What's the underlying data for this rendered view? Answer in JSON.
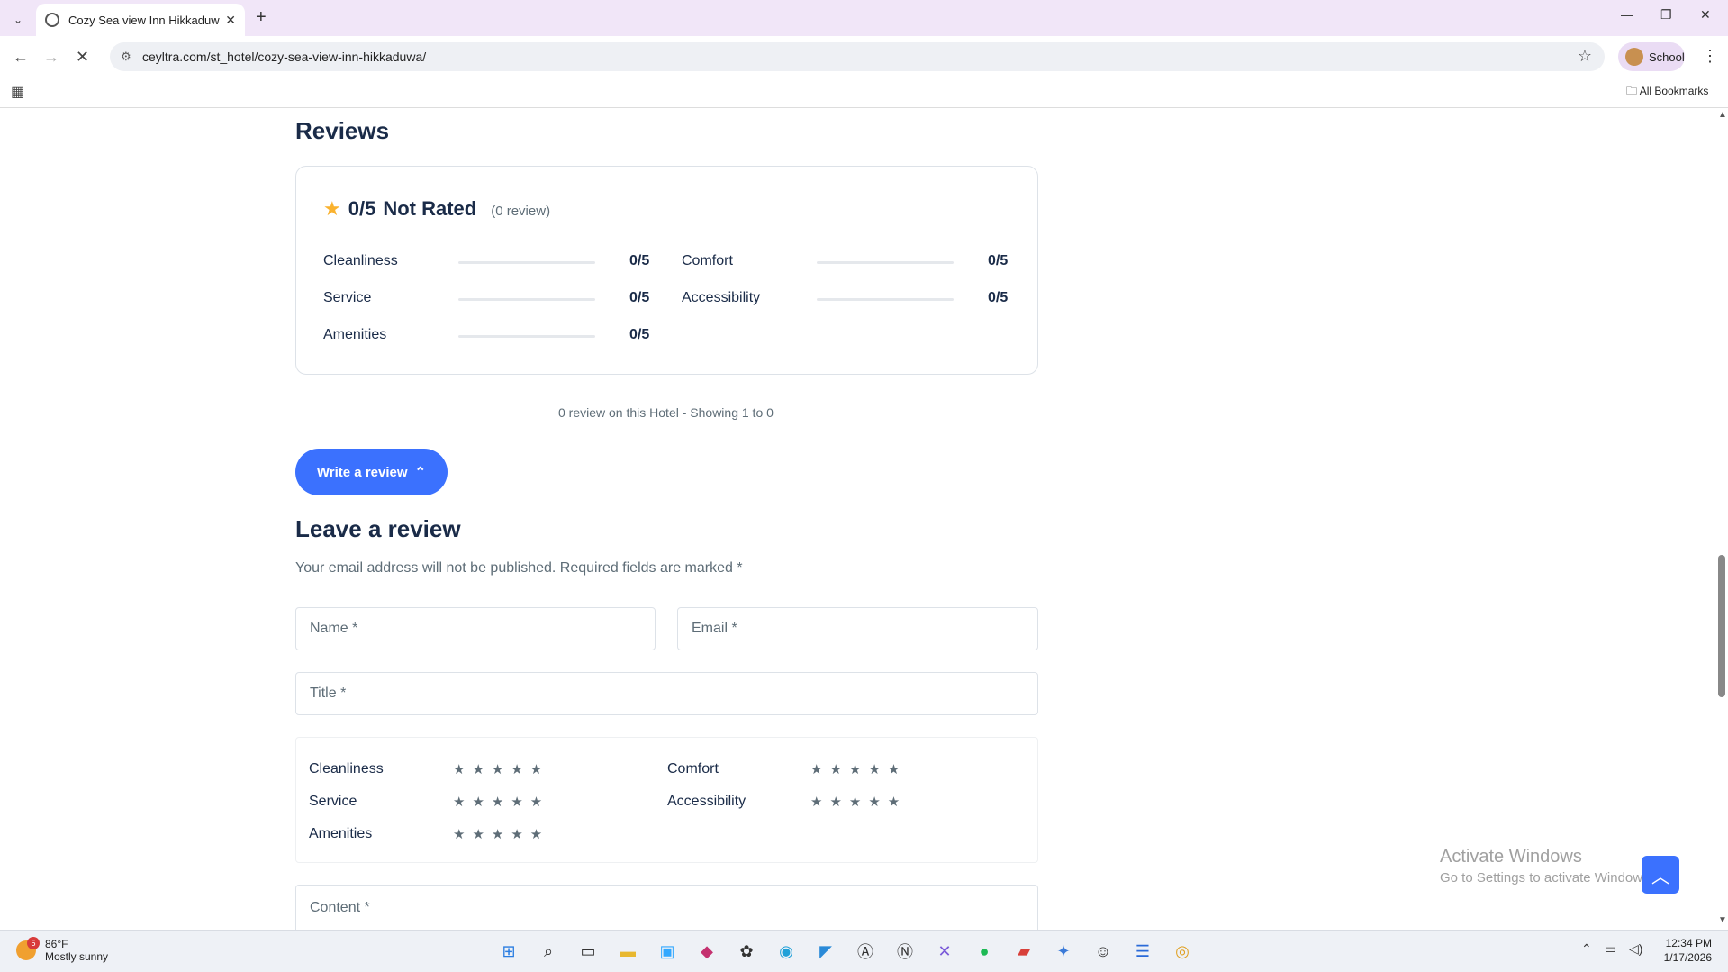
{
  "browser": {
    "tab_title": "Cozy Sea view Inn Hikkaduwa -",
    "url": "ceyltra.com/st_hotel/cozy-sea-view-inn-hikkaduwa/",
    "profile_label": "School",
    "bookmarks_label": "All Bookmarks"
  },
  "reviews": {
    "heading": "Reviews",
    "score": "0/5",
    "status": "Not Rated",
    "count": "(0 review)",
    "criteria": [
      {
        "label": "Cleanliness",
        "value": "0/5"
      },
      {
        "label": "Comfort",
        "value": "0/5"
      },
      {
        "label": "Service",
        "value": "0/5"
      },
      {
        "label": "Accessibility",
        "value": "0/5"
      },
      {
        "label": "Amenities",
        "value": "0/5"
      }
    ],
    "showing": "0 review on this Hotel - Showing 1 to 0",
    "write_button": "Write a review"
  },
  "form": {
    "heading": "Leave a review",
    "note": "Your email address will not be published. Required fields are marked *",
    "name_placeholder": "Name *",
    "email_placeholder": "Email *",
    "title_placeholder": "Title *",
    "content_placeholder": "Content *",
    "ratings": [
      {
        "label": "Cleanliness",
        "stars": "★★★★★"
      },
      {
        "label": "Comfort",
        "stars": "★★★★★"
      },
      {
        "label": "Service",
        "stars": "★★★★★"
      },
      {
        "label": "Accessibility",
        "stars": "★★★★★"
      },
      {
        "label": "Amenities",
        "stars": "★★★★★"
      }
    ]
  },
  "watermark": {
    "line1": "Activate Windows",
    "line2": "Go to Settings to activate Windows."
  },
  "taskbar": {
    "temp": "86°F",
    "weather": "Mostly sunny",
    "badge": "5",
    "time": "12:34 PM",
    "date": "1/17/2026"
  }
}
